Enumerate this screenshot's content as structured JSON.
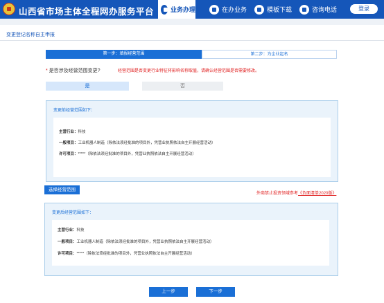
{
  "header": {
    "site_title": "山西省市场主体全程网办服务平台",
    "nav": [
      {
        "label": "业务办理",
        "icon": "briefcase-icon",
        "active": true
      },
      {
        "label": "在办业务",
        "icon": "document-icon",
        "active": false
      },
      {
        "label": "模板下载",
        "icon": "download-icon",
        "active": false
      },
      {
        "label": "咨询电话",
        "icon": "phone-icon",
        "active": false
      }
    ],
    "login_label": "登录"
  },
  "page": {
    "title": "变更登记名称自主申报"
  },
  "steps": [
    {
      "label": "第一步：填报经营范围"
    },
    {
      "label": "第二步：为企业起名"
    }
  ],
  "question": {
    "required_mark": "*",
    "text": "是否涉及经营范围变更?",
    "warning": "经营范围是否变更行业特征将影响名称取值，请确认经营范围是否需要修改。",
    "yes_label": "是",
    "no_label": "否"
  },
  "before_box": {
    "title": "变更前经营范围如下：",
    "industry_label": "主营行业：",
    "industry_value": "科技",
    "general_label": "一般项目：",
    "general_value": "工业机器人制造（除依法须经批准的项目外，凭营业执照依法自主开展经营活动）",
    "permit_label": "许可项目：",
    "permit_value": "*****（除依法须经批准的项目外，凭营业执照依法自主开展经营活动）"
  },
  "change_button_label": "选择经营范围",
  "note": {
    "text": "外商禁止投资领域参考",
    "link": "《负面清单2020版》"
  },
  "after_box": {
    "title": "变更后经营范围如下：",
    "industry_label": "主营行业：",
    "industry_value": "科技",
    "general_label": "一般项目：",
    "general_value": "工业机器人制造（除依法须经批准的项目外，凭营业执照依法自主开展经营活动）",
    "permit_label": "许可项目：",
    "permit_value": "*****（除依法须经批准的项目外，凭营业执照依法自主开展经营活动）"
  },
  "footer": {
    "prev_label": "上一步",
    "next_label": "下一步"
  },
  "colors": {
    "brand": "#1556b9",
    "accent": "#1a6fd6",
    "warning": "#e02020"
  }
}
